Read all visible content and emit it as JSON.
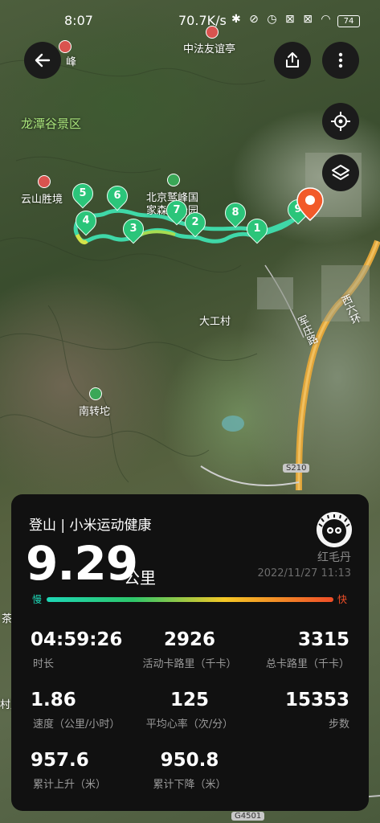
{
  "status_bar": {
    "time": "8:07",
    "net_speed": "70.7K/s",
    "status_icons": "✱ ⊘ ◷ ⊠ ⊠ ◠",
    "battery": "74"
  },
  "map": {
    "labels": {
      "peak_top": "峰",
      "friendship_pavilion": "中法友谊亭",
      "longtan_valley": "龙潭谷景区",
      "yunshan": "云山胜境",
      "park_line1": "北京鹫峰国",
      "park_line2": "家森林公园",
      "dagongcun": "大工村",
      "nanzhuantuo": "南转坨",
      "west_sixth_ring": "西六环",
      "jundu_road": "军庄路",
      "tea": "茶",
      "village": "村庄"
    },
    "road_signs": {
      "s210": "S210",
      "g4501": "G4501"
    },
    "markers": [
      "1",
      "2",
      "3",
      "4",
      "5",
      "6",
      "7",
      "8",
      "9"
    ],
    "icons": {
      "back": "arrow-left-icon",
      "share": "share-icon",
      "more": "more-vertical-icon",
      "locate": "locate-icon",
      "layers": "layers-icon"
    }
  },
  "card": {
    "title": "登山 | 小米运动健康",
    "distance": "9.29",
    "distance_unit": "公里",
    "username": "红毛丹",
    "datetime": "2022/11/27 11:13",
    "pace_slow": "慢",
    "pace_fast": "快",
    "stats": [
      {
        "value": "04:59:26",
        "label": "时长"
      },
      {
        "value": "2926",
        "label": "活动卡路里（千卡）"
      },
      {
        "value": "3315",
        "label": "总卡路里（千卡）"
      },
      {
        "value": "1.86",
        "label": "速度（公里/小时）"
      },
      {
        "value": "125",
        "label": "平均心率（次/分）"
      },
      {
        "value": "15353",
        "label": "步数"
      },
      {
        "value": "957.6",
        "label": "累计上升（米）"
      },
      {
        "value": "950.8",
        "label": "累计下降（米）"
      }
    ]
  }
}
